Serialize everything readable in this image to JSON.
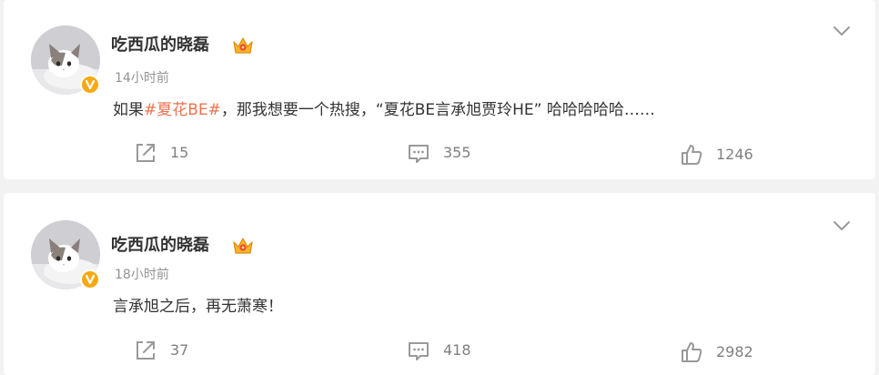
{
  "posts": [
    {
      "username": "吃西瓜的晓磊",
      "timestamp": "14小时前",
      "text_before": "如果",
      "hashtag": "#夏花BE#",
      "text_after": "，那我想要一个热搜，“夏花BE言承旭贾玲HE” 哈哈哈哈哈……",
      "shares": "15",
      "comments": "355",
      "likes": "1246"
    },
    {
      "username": "吃西瓜的晓磊",
      "timestamp": "18小时前",
      "text_before": "言承旭之后，再无萧寒！",
      "hashtag": "",
      "text_after": "",
      "shares": "37",
      "comments": "418",
      "likes": "2982"
    }
  ],
  "icons": {
    "avatar": "cat-avatar-icon",
    "verified": "verified-badge-icon",
    "vip": "crown-icon",
    "menu": "chevron-down-icon",
    "share": "share-icon",
    "comment": "comment-icon",
    "like": "thumbs-up-icon"
  },
  "colors": {
    "hashtag": "#eb7350",
    "verified": "#f7a912",
    "text": "#333333",
    "muted": "#939393",
    "background": "#f2f2f2"
  }
}
